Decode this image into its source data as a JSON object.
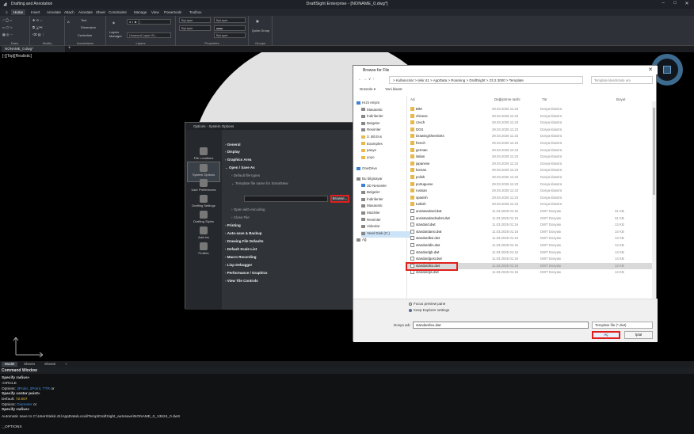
{
  "titlebar": {
    "workspace": "Drafting and Annotation",
    "title": "DraftSight Enterprise - [NONAME_0.dwg*]",
    "min": "–",
    "max": "□",
    "close": "✕"
  },
  "ribbon": {
    "tabs": [
      "Home",
      "Insert",
      "Annotate",
      "Attach",
      "Annotate",
      "Sheet",
      "Constraints",
      "Manage",
      "View",
      "Powertools",
      "Toolbox"
    ],
    "groups": {
      "draw": "Draw",
      "modify": "Modify",
      "annotations": "Annotations",
      "layers": "Layers",
      "properties": "Properties",
      "groups": "Groups"
    },
    "items": {
      "text": "Text",
      "dimension": "Dimension",
      "centerline": "Centerline",
      "layers_manager": "Layers Manager",
      "layer_value": "Unsaved Layer St...",
      "bylayer1": "ByLayer",
      "bylayer2": "ByLayer",
      "bylayer3": "ByLayer",
      "bylayer4": "ByLayer",
      "quick_group": "Quick Group"
    }
  },
  "doc_tab": "NONAME_0.dwg*",
  "doc_tab_plus": "+",
  "canvas": {
    "view_label": "[-][Top][Realistic]"
  },
  "options": {
    "title": "Options - System Options",
    "sidebar": [
      "File Locations",
      "System Options",
      "User Preferences",
      "Drafting Settings",
      "Drafting Styles",
      "Add-Ins",
      "Profiles"
    ],
    "rows": {
      "general": "General",
      "display": "Display",
      "graphics_area": "Graphics Area",
      "open_save": "Open / Save As",
      "default_file_types": "Default file types",
      "template_smartnew": "Template file name for SmartNew",
      "open_encoding": "Open with encoding",
      "close_file": "Close File",
      "printing": "Printing",
      "autosave": "Auto-save & Backup",
      "drawing_defaults": "Drawing File Defaults",
      "default_scale": "Default Scale List",
      "macro": "Macro Recording",
      "debugger": "Lisp Debugger",
      "performance": "Performance / Graphics",
      "tile_controls": "View Tile Controls"
    },
    "browse_button": "Browse..."
  },
  "browse": {
    "title": "Browse for File",
    "close": "✕",
    "nav": "←  →  ∨  ↑",
    "address": ">  Kullanıcılar  >  tekir.41  >  AppData  >  Roaming  >  DraftSight  >  23.2.3000  >  Template",
    "search_placeholder": "Template klasöründe ara",
    "tools": {
      "organize": "Düzenle ▾",
      "new_folder": "Yeni klasör"
    },
    "tree": [
      "Hızlı erişim",
      "Masaüstü",
      "İndirilenler",
      "Belgeler",
      "Resimler",
      "3. Bil.Ens",
      "Examples",
      "pasye",
      "yoyo",
      "OneDrive",
      "Bu bilgisayar",
      "3D Nesneler",
      "Belgeler",
      "İndirilenler",
      "Masaüstü",
      "Müzikler",
      "Resimler",
      "Videolar",
      "Yerel Disk (C:)",
      "Ağ"
    ],
    "columns": {
      "name": "Ad",
      "date": "Değiştirme tarihi",
      "type": "Tür",
      "size": "Boyut"
    },
    "files": [
      {
        "name": "BIM",
        "date": "29.03.2025 11:23",
        "type": "Dosya klasörü",
        "size": ""
      },
      {
        "name": "chinese",
        "date": "29.03.2025 11:23",
        "type": "Dosya klasörü",
        "size": ""
      },
      {
        "name": "czech",
        "date": "29.03.2025 11:23",
        "type": "Dosya klasörü",
        "size": ""
      },
      {
        "name": "DGS",
        "date": "29.03.2025 11:23",
        "type": "Dosya klasörü",
        "size": ""
      },
      {
        "name": "DrawingSheetSets",
        "date": "29.03.2025 11:23",
        "type": "Dosya klasörü",
        "size": ""
      },
      {
        "name": "french",
        "date": "29.03.2025 11:23",
        "type": "Dosya klasörü",
        "size": ""
      },
      {
        "name": "german",
        "date": "29.03.2025 11:23",
        "type": "Dosya klasörü",
        "size": ""
      },
      {
        "name": "italian",
        "date": "29.03.2025 11:23",
        "type": "Dosya klasörü",
        "size": ""
      },
      {
        "name": "japanese",
        "date": "29.03.2025 11:23",
        "type": "Dosya klasörü",
        "size": ""
      },
      {
        "name": "korean",
        "date": "29.03.2025 11:23",
        "type": "Dosya klasörü",
        "size": ""
      },
      {
        "name": "polish",
        "date": "29.03.2025 11:23",
        "type": "Dosya klasörü",
        "size": ""
      },
      {
        "name": "portuguese",
        "date": "29.03.2025 11:23",
        "type": "Dosya klasörü",
        "size": ""
      },
      {
        "name": "russian",
        "date": "29.03.2025 11:23",
        "type": "Dosya klasörü",
        "size": ""
      },
      {
        "name": "spanish",
        "date": "29.03.2025 11:23",
        "type": "Dosya klasörü",
        "size": ""
      },
      {
        "name": "turkish",
        "date": "29.03.2025 11:23",
        "type": "Dosya klasörü",
        "size": ""
      },
      {
        "name": "ansistandard.dwt",
        "date": "11.03.2025 01:16",
        "type": "DWT Dosyası",
        "size": "31 KB"
      },
      {
        "name": "ansistandardsubst.dwt",
        "date": "11.03.2025 01:16",
        "type": "DWT Dosyası",
        "size": "31 KB"
      },
      {
        "name": "standard.dwt",
        "date": "11.03.2025 01:16",
        "type": "DWT Dosyası",
        "size": "13 KB"
      },
      {
        "name": "standardansi.dwt",
        "date": "11.03.2025 01:16",
        "type": "DWT Dosyası",
        "size": "14 KB"
      },
      {
        "name": "standardbsi.dwt",
        "date": "11.03.2025 01:16",
        "type": "DWT Dosyası",
        "size": "14 KB"
      },
      {
        "name": "standarddin.dwt",
        "date": "11.03.2025 01:16",
        "type": "DWT Dosyası",
        "size": "14 KB"
      },
      {
        "name": "standardgb.dwt",
        "date": "11.03.2025 01:16",
        "type": "DWT Dosyası",
        "size": "14 KB"
      },
      {
        "name": "standardgost.dwt",
        "date": "11.03.2025 01:16",
        "type": "DWT Dosyası",
        "size": "14 KB"
      },
      {
        "name": "standardiso.dwt",
        "date": "11.03.2025 01:16",
        "type": "DWT Dosyası",
        "size": "13 KB"
      },
      {
        "name": "standardjis.dwt",
        "date": "11.03.2025 01:16",
        "type": "DWT Dosyası",
        "size": "14 KB"
      }
    ],
    "radios": {
      "focus_preview": "Focus preview pane",
      "keep_explorer": "Keep Explorer settings"
    },
    "file_name_label": "Dosya adı:",
    "file_name_value": "standardiso.dwt",
    "file_type": "Template file (*.dwt)",
    "ok": "Aç",
    "cancel": "İptal"
  },
  "layout_tabs": [
    "Model",
    "Sheet1",
    "Sheet2",
    "+"
  ],
  "command": {
    "title": "Command Window",
    "lines": {
      "l1": "Specify radius»",
      "l2": ":CIRCLE",
      "l3a": "Options: ",
      "l3b": "3Point, 2Point, TTR",
      "l3c": " or",
      "l4": "Specify center point»",
      "l5a": "Default: ",
      "l5b": "72.007",
      "l6a": "Options: ",
      "l6b": "Diameter",
      "l6c": " or",
      "l7": "Specify radius»",
      "l8": "Automatic save to C:\\Users\\tekir.41\\AppData\\Local\\Temp\\DraftSight_autosave\\NONAME_0_13624_0.dwS",
      "l9": ":_OPTIONS"
    }
  }
}
